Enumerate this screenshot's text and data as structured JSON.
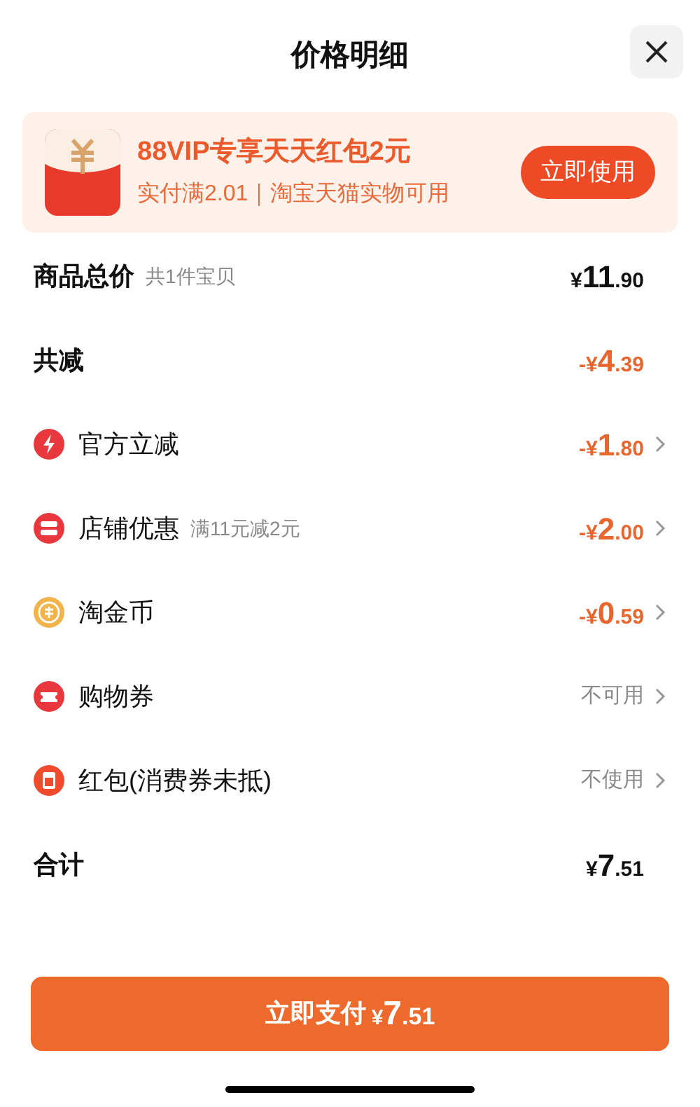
{
  "title": "价格明细",
  "banner": {
    "headline": "88VIP专享天天红包2元",
    "condition": "实付满2.01｜淘宝天猫实物可用",
    "button": "立即使用"
  },
  "rows": [
    {
      "kind": "total",
      "label": "商品总价",
      "note": "共1件宝贝",
      "value": "¥11.90"
    },
    {
      "kind": "reduction",
      "label": "共减",
      "value": "-¥4.39"
    },
    {
      "kind": "discount",
      "label": "官方立减",
      "value": "-¥1.80"
    },
    {
      "kind": "discount",
      "label": "店铺优惠",
      "note": "满11元减2元",
      "value": "-¥2.00"
    },
    {
      "kind": "discount",
      "label": "淘金币",
      "value": "-¥0.59"
    },
    {
      "kind": "option",
      "label": "购物券",
      "value": "不可用"
    },
    {
      "kind": "option",
      "label": "红包(消费券未抵)",
      "value": "不使用"
    },
    {
      "kind": "sum",
      "label": "合计",
      "value": "¥7.51"
    }
  ],
  "pay_button": {
    "label": "立即支付",
    "amount": "¥7.51"
  }
}
